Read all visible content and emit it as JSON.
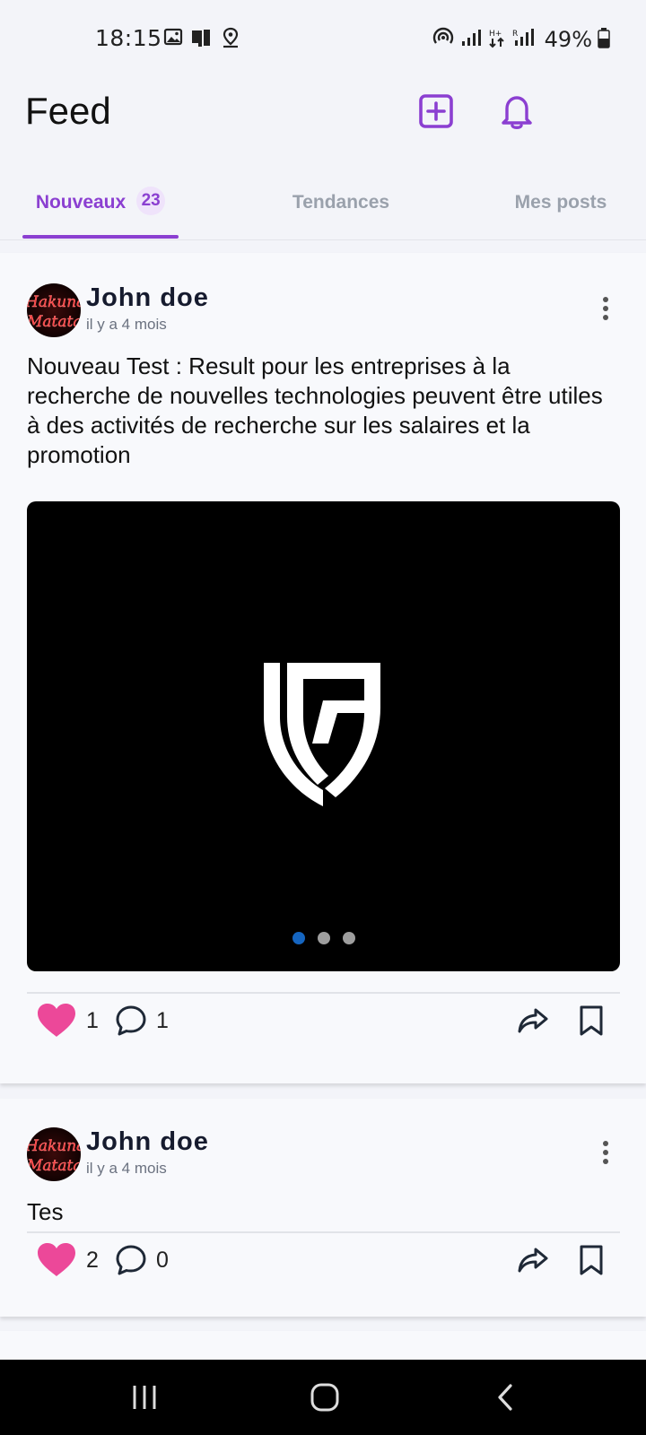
{
  "status_bar": {
    "time": "18:15",
    "battery": "49%",
    "icons": [
      "gallery-icon",
      "device-icon",
      "location-icon",
      "hotspot-icon",
      "signal-icon",
      "data-icon",
      "signal-roaming-icon",
      "battery-icon"
    ]
  },
  "header": {
    "title": "Feed",
    "actions": [
      "add-post-icon",
      "bell-icon"
    ]
  },
  "tabs": [
    {
      "label": "Nouveaux",
      "badge": "23",
      "active": true
    },
    {
      "label": "Tendances",
      "active": false
    },
    {
      "label": "Mes posts",
      "active": false
    }
  ],
  "posts": [
    {
      "author": "John doe",
      "time": "il y a 4 mois",
      "text": "Nouveau Test : Result pour les entreprises à la recherche de nouvelles technologies peuvent être utiles à des activités de recherche sur les salaires et la promotion",
      "media_pages": 3,
      "media_active_page": 1,
      "likes": "1",
      "comments": "1"
    },
    {
      "author": "John doe",
      "time": "il y a 4 mois",
      "text": "Tes",
      "likes": "2",
      "comments": "0"
    }
  ],
  "colors": {
    "accent": "#8b3fd1",
    "like": "#ec4899",
    "dot_active": "#1565c0",
    "background": "#f3f4f9"
  }
}
